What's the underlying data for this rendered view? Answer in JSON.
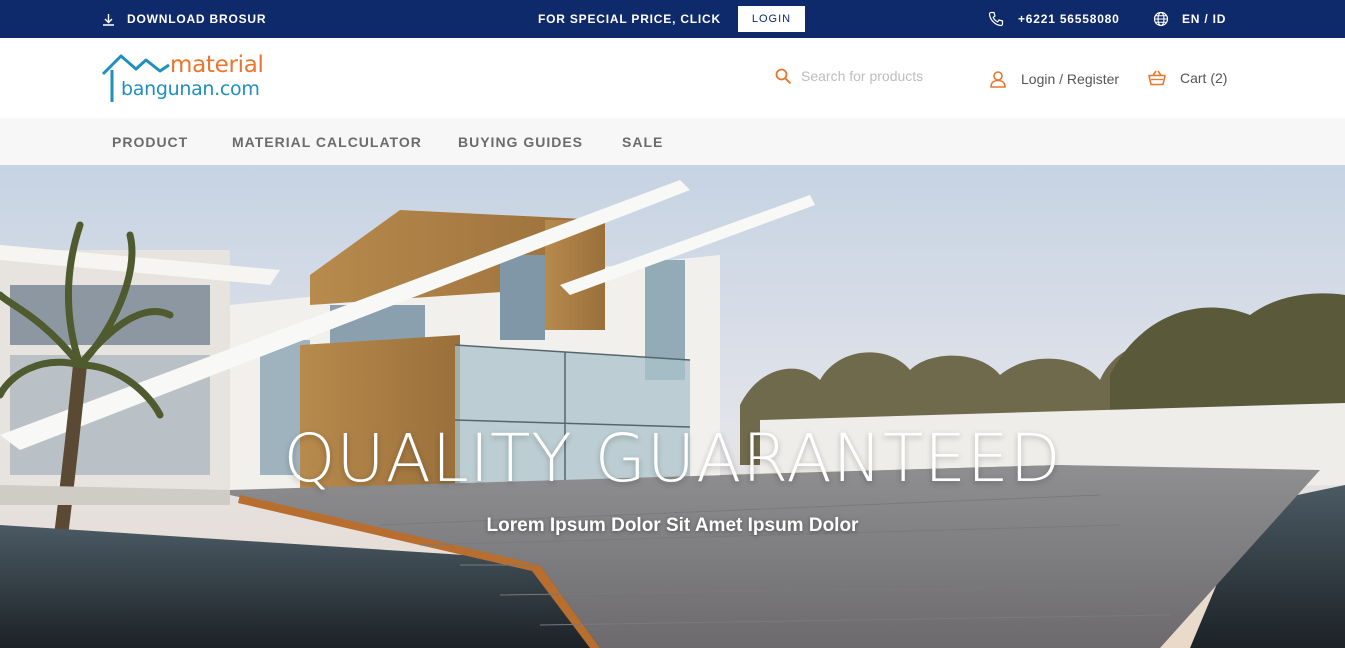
{
  "topbar": {
    "download_label": "DOWNLOAD BROSUR",
    "special_text": "FOR SPECIAL PRICE, CLICK",
    "login_button": "LOGIN",
    "phone": "+6221 56558080",
    "language": "EN / ID"
  },
  "header": {
    "logo_line1": "material",
    "logo_line2": "bangunan.com",
    "search_placeholder": "Search for products",
    "account_label": "Login / Register",
    "cart_label": "Cart (2)"
  },
  "nav": {
    "items": [
      "PRODUCT",
      "MATERIAL CALCULATOR",
      "BUYING GUIDES",
      "SALE"
    ]
  },
  "hero": {
    "title": "QUALITY GUARANTEED",
    "subtitle": "Lorem Ipsum Dolor Sit Amet Ipsum Dolor"
  },
  "colors": {
    "topbar_bg": "#0f2a6b",
    "accent_orange": "#e9762b",
    "logo_blue": "#1e8fc0"
  }
}
